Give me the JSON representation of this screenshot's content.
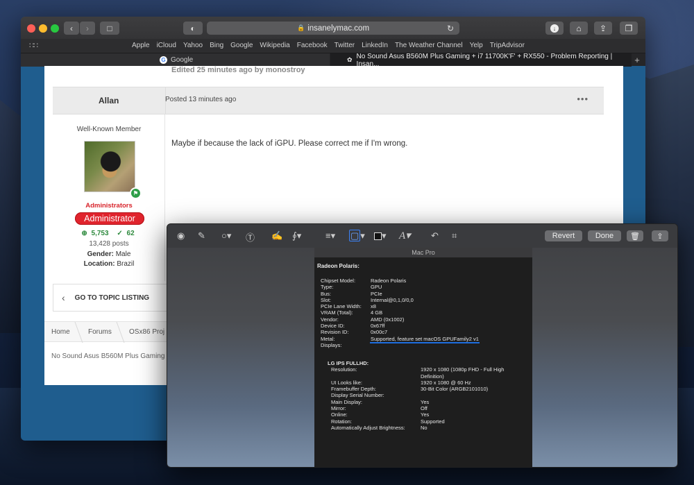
{
  "browser": {
    "address": "insanelymac.com",
    "favorites": [
      "Apple",
      "iCloud",
      "Yahoo",
      "Bing",
      "Google",
      "Wikipedia",
      "Facebook",
      "Twitter",
      "LinkedIn",
      "The Weather Channel",
      "Yelp",
      "TripAdvisor"
    ],
    "tabs": [
      {
        "label": "Google"
      },
      {
        "label": "No Sound Asus B560M Plus Gaming + i7 11700K'F' + RX550 - Problem Reporting | Insan..."
      }
    ]
  },
  "post": {
    "edited_note": "Edited 25 minutes ago by monostroy",
    "author": "Allan",
    "posted": "Posted 13 minutes ago",
    "member_title": "Well-Known Member",
    "group": "Administrators",
    "group_badge": "Administrator",
    "rep": "5,753",
    "solutions": "62",
    "posts": "13,428 posts",
    "gender_label": "Gender:",
    "gender": "Male",
    "location_label": "Location:",
    "location": "Brazil",
    "body": "Maybe if because the lack of iGPU. Please correct me if I'm wrong.",
    "go_to_topic": "GO TO TOPIC LISTING"
  },
  "breadcrumb": {
    "items": [
      "Home",
      "Forums",
      "OSx86 Proj"
    ],
    "title": "No Sound Asus B560M Plus Gaming"
  },
  "markup": {
    "revert": "Revert",
    "done": "Done"
  },
  "sysinfo": {
    "window_title": "Mac Pro",
    "heading": "Radeon Polaris:",
    "rows": [
      {
        "label": "Chipset Model:",
        "value": "Radeon Polaris"
      },
      {
        "label": "Type:",
        "value": "GPU"
      },
      {
        "label": "Bus:",
        "value": "PCIe"
      },
      {
        "label": "Slot:",
        "value": "Internal@0,1,0/0,0"
      },
      {
        "label": "PCIe Lane Width:",
        "value": "x8"
      },
      {
        "label": "VRAM (Total):",
        "value": "4 GB"
      },
      {
        "label": "Vendor:",
        "value": "AMD (0x1002)"
      },
      {
        "label": "Device ID:",
        "value": "0x67ff"
      },
      {
        "label": "Revision ID:",
        "value": "0x00c7"
      },
      {
        "label": "Metal:",
        "value": "Supported, feature set macOS GPUFamily2 v1"
      },
      {
        "label": "Displays:",
        "value": ""
      }
    ],
    "display_name": "LG IPS FULLHD:",
    "display_rows": [
      {
        "label": "Resolution:",
        "value": "1920 x 1080 (1080p FHD - Full High Definition)"
      },
      {
        "label": "UI Looks like:",
        "value": "1920 x 1080 @ 60 Hz"
      },
      {
        "label": "Framebuffer Depth:",
        "value": "30-Bit Color (ARGB2101010)"
      },
      {
        "label": "Display Serial Number:",
        "value": ""
      },
      {
        "label": "Main Display:",
        "value": "Yes"
      },
      {
        "label": "Mirror:",
        "value": "Off"
      },
      {
        "label": "Online:",
        "value": "Yes"
      },
      {
        "label": "Rotation:",
        "value": "Supported"
      },
      {
        "label": "Automatically Adjust Brightness:",
        "value": "No"
      }
    ]
  }
}
